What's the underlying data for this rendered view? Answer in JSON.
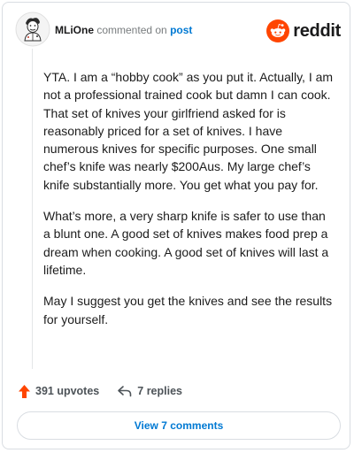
{
  "comment": {
    "username": "MLiOne",
    "action_text": "commented on",
    "post_link": "post",
    "body": [
      "YTA. I am a “hobby cook” as you put it. Actually, I am not a professional trained cook but damn I can cook. That set of knives your girlfriend asked for is reasonably priced for a set of knives. I have numerous knives for specific purposes. One small chef’s knife was nearly $200Aus. My large chef’s knife substantially more. You get what you pay for.",
      "What’s more, a very sharp knife is safer to use than a blunt one. A good set of knives makes food prep a dream when cooking. A good set of knives will last a lifetime.",
      "May I suggest you get the knives and see the results for yourself."
    ],
    "upvotes": "391 upvotes",
    "replies": "7 replies",
    "view_button": "View 7 comments"
  },
  "brand": {
    "name": "reddit",
    "color": "#ff4500"
  },
  "icons": {
    "avatar": "user-avatar",
    "brand": "reddit-snoo-icon",
    "upvote": "upvote-arrow-icon",
    "reply": "reply-arrow-icon"
  },
  "colors": {
    "link": "#0079d3",
    "upvote": "#ff4500",
    "muted": "#787c7e"
  }
}
